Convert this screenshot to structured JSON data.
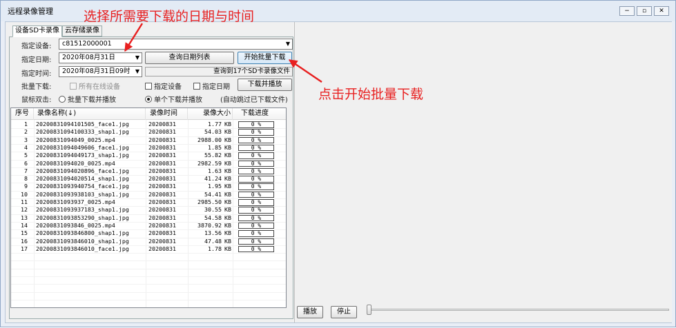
{
  "window": {
    "title": "远程录像管理",
    "minimize": "−",
    "restore": "▫",
    "close": "✕"
  },
  "tabs": [
    {
      "label": "设备SD卡录像"
    },
    {
      "label": "云存储录像"
    }
  ],
  "form": {
    "device_label": "指定设备:",
    "device_value": "c81512000001",
    "date_label": "指定日期:",
    "date_value": "2020年08月31日",
    "time_label": "指定时间:",
    "time_value": "2020年08月31日09时",
    "query_dates_button": "查询日期列表",
    "start_batch_button": "开始批量下载",
    "query_status": "查询到17个SD卡录像文件",
    "batch_label": "批量下载:",
    "opt_all_online": "所有在线设备",
    "opt_device": "指定设备",
    "opt_date": "指定日期",
    "download_play_button": "下载并播放",
    "dblclick_label": "鼠标双击:",
    "radio_batch_play": "批量下载并播放",
    "radio_single_play": "单个下载并播放",
    "auto_skip_note": "(自动跳过已下载文件)",
    "selected_radio": "单个下载并播放"
  },
  "table": {
    "columns": [
      "序号",
      "录像名称(↓)",
      "录像时间",
      "录像大小",
      "下载进度"
    ],
    "unit": "KB",
    "rows": [
      {
        "no": "1",
        "name": "20200831094101505_face1.jpg",
        "time": "20200831",
        "size": "1.77",
        "progress": "0 %"
      },
      {
        "no": "2",
        "name": "20200831094100333_shap1.jpg",
        "time": "20200831",
        "size": "54.03",
        "progress": "0 %"
      },
      {
        "no": "3",
        "name": "20200831094049_0025.mp4",
        "time": "20200831",
        "size": "2988.00",
        "progress": "0 %"
      },
      {
        "no": "4",
        "name": "20200831094049606_face1.jpg",
        "time": "20200831",
        "size": "1.85",
        "progress": "0 %"
      },
      {
        "no": "5",
        "name": "20200831094049173_shap1.jpg",
        "time": "20200831",
        "size": "55.82",
        "progress": "0 %"
      },
      {
        "no": "6",
        "name": "20200831094020_0025.mp4",
        "time": "20200831",
        "size": "2982.59",
        "progress": "0 %"
      },
      {
        "no": "7",
        "name": "20200831094020896_face1.jpg",
        "time": "20200831",
        "size": "1.63",
        "progress": "0 %"
      },
      {
        "no": "8",
        "name": "20200831094020514_shap1.jpg",
        "time": "20200831",
        "size": "41.24",
        "progress": "0 %"
      },
      {
        "no": "9",
        "name": "20200831093940754_face1.jpg",
        "time": "20200831",
        "size": "1.95",
        "progress": "0 %"
      },
      {
        "no": "10",
        "name": "20200831093938103_shap1.jpg",
        "time": "20200831",
        "size": "54.41",
        "progress": "0 %"
      },
      {
        "no": "11",
        "name": "20200831093937_0025.mp4",
        "time": "20200831",
        "size": "2985.50",
        "progress": "0 %"
      },
      {
        "no": "12",
        "name": "20200831093937183_shap1.jpg",
        "time": "20200831",
        "size": "30.55",
        "progress": "0 %"
      },
      {
        "no": "13",
        "name": "20200831093853290_shap1.jpg",
        "time": "20200831",
        "size": "54.58",
        "progress": "0 %"
      },
      {
        "no": "14",
        "name": "20200831093846_0025.mp4",
        "time": "20200831",
        "size": "3870.92",
        "progress": "0 %"
      },
      {
        "no": "15",
        "name": "20200831093846800_shap1.jpg",
        "time": "20200831",
        "size": "13.56",
        "progress": "0 %"
      },
      {
        "no": "16",
        "name": "20200831093846010_shap1.jpg",
        "time": "20200831",
        "size": "47.48",
        "progress": "0 %"
      },
      {
        "no": "17",
        "name": "20200831093846010_face1.jpg",
        "time": "20200831",
        "size": "1.78",
        "progress": "0 %"
      }
    ]
  },
  "player": {
    "play_button": "播放",
    "stop_button": "停止",
    "slider_value": 0
  },
  "annotations": {
    "top": "选择所需要下载的日期与时间",
    "right": "点击开始批量下载",
    "color": "#e82020"
  }
}
